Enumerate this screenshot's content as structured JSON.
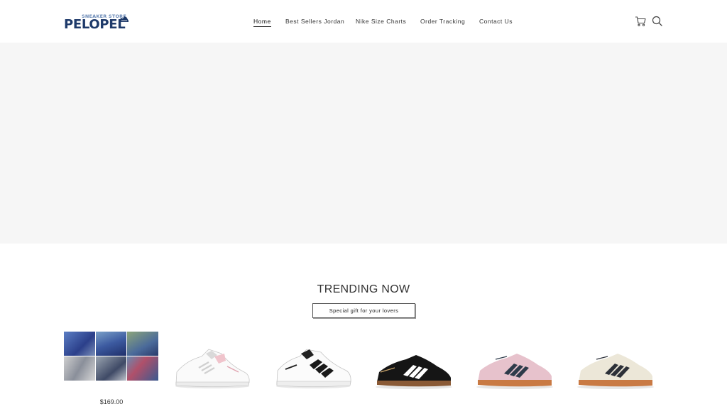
{
  "brand": {
    "small": "SNEAKER STORE",
    "big": "PELOPEL"
  },
  "nav": {
    "items": [
      {
        "label": "Home",
        "active": true
      },
      {
        "label": "Best Sellers Jordan",
        "active": false
      },
      {
        "label": "Nike Size Charts",
        "active": false
      },
      {
        "label": "Order Tracking",
        "active": false
      },
      {
        "label": "Contact Us",
        "active": false
      }
    ]
  },
  "icons": {
    "cart": "cart-icon",
    "search": "search-icon"
  },
  "trending": {
    "title": "TRENDING NOW",
    "button_label": "Special gift for your lovers"
  },
  "products": [
    {
      "image": "sneaker-collage",
      "price": "$169.00"
    },
    {
      "image": "white-pink-forum-low",
      "price": ""
    },
    {
      "image": "white-black-forum-low",
      "price": ""
    },
    {
      "image": "black-handball-spezial",
      "price": ""
    },
    {
      "image": "pink-handball-spezial",
      "price": ""
    },
    {
      "image": "cream-handball-spezial",
      "price": ""
    }
  ],
  "colors": {
    "brand_navy": "#1e3a6a",
    "brand_light": "#6a89b6",
    "hero_bg": "#f6f6f6"
  }
}
